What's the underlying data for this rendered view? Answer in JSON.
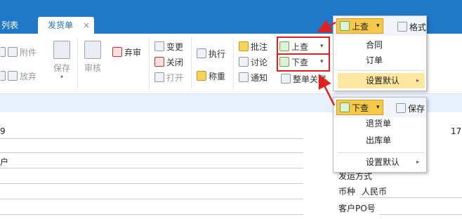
{
  "tabs": {
    "list_label": "列表",
    "active_label": "发货单",
    "close_glyph": "×"
  },
  "ribbon": {
    "attach": "附件",
    "discard_partial": "放弃",
    "save": "保存",
    "review": "审核",
    "abandon": "弃审",
    "change": "变更",
    "close": "关闭",
    "open": "打开",
    "execute": "执行",
    "weigh": "称重",
    "annotate": "批注",
    "discuss": "讨论",
    "notify": "通知",
    "query_up": "上查",
    "query_down": "下查",
    "whole_link": "整单关联"
  },
  "form": {
    "row1_value": "9",
    "row2_value": "户",
    "ship_method_label": "发运方式",
    "currency_label": "币种",
    "currency_value": "人民币",
    "customer_po_label": "客户PO号",
    "right_number": "17"
  },
  "menu_up": {
    "button": "上查",
    "side": "格式",
    "items": [
      "合同",
      "订单",
      "设置默认"
    ]
  },
  "menu_down": {
    "button": "下查",
    "side": "保存",
    "items": [
      "退货单",
      "出库单",
      "设置默认"
    ]
  },
  "colors": {
    "tabbar": "#1f79c8",
    "highlight_box": "#e02020",
    "menu_active": "#f6c94a",
    "menu_hover": "#fde79e"
  }
}
